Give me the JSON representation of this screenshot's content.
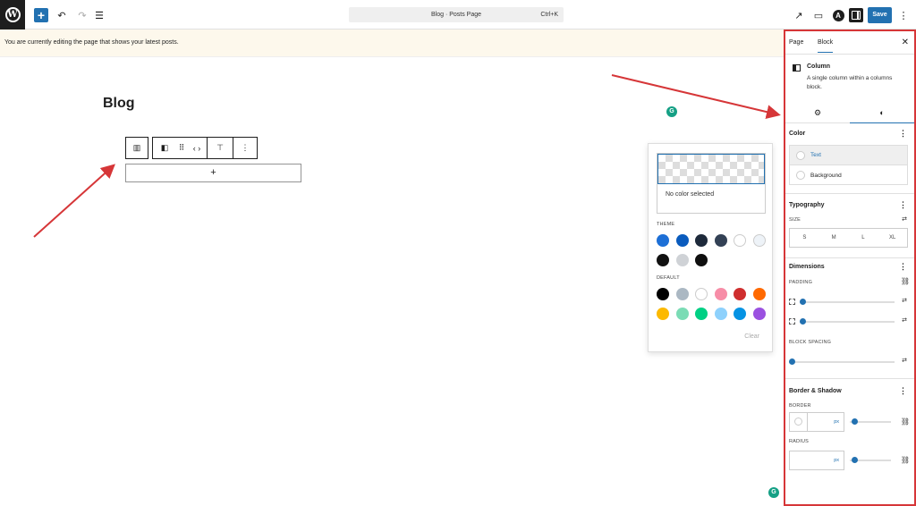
{
  "topbar": {
    "logo_letter": "W",
    "add_symbol": "+",
    "undo_icon": "↶",
    "redo_icon": "↷",
    "doc_overview_icon": "☰",
    "command": {
      "title": "Blog · Posts Page",
      "shortcut": "Ctrl+K"
    },
    "external_icon": "↗",
    "preview_icon": "▭",
    "astra_letter": "A",
    "save_label": "Save",
    "more_icon": "⋮"
  },
  "notice": {
    "text": "You are currently editing the page that shows your latest posts."
  },
  "canvas": {
    "page_title": "Blog",
    "block_toolbar": {
      "parent_icon": "▥",
      "column_icon": "◧",
      "drag_icon": "⠿",
      "move_icon": "‹ ›",
      "align_icon": "⊤",
      "options_icon": "⋮"
    },
    "add_block_symbol": "+",
    "grammarly_letter": "G"
  },
  "color_popover": {
    "no_color_label": "No color selected",
    "theme_label": "THEME",
    "theme_colors": [
      "#1d6fd6",
      "#0a5bbd",
      "#1e2a3b",
      "#334155",
      "#ffffff",
      "#eef3f8",
      "#111111",
      "#cfd2d6",
      "#0f0f0f"
    ],
    "default_label": "DEFAULT",
    "default_colors": [
      "#000000",
      "#abb8c3",
      "#ffffff",
      "#f78da7",
      "#cf2e2e",
      "#ff6900",
      "#fcb900",
      "#7bdcb5",
      "#00d084",
      "#8ed1fc",
      "#0693e3",
      "#9b51e0"
    ],
    "clear_label": "Clear"
  },
  "sidebar": {
    "tabs": [
      "Page",
      "Block"
    ],
    "close_icon": "✕",
    "block": {
      "name": "Column",
      "description": "A single column within a columns block."
    },
    "settings_icon": "⚙",
    "styles_icon": "◐",
    "color": {
      "title": "Color",
      "items": [
        "Text",
        "Background"
      ]
    },
    "typography": {
      "title": "Typography",
      "size_label": "SIZE",
      "sizes": [
        "S",
        "M",
        "L",
        "XL"
      ]
    },
    "dimensions": {
      "title": "Dimensions",
      "padding_label": "PADDING",
      "block_spacing_label": "BLOCK SPACING"
    },
    "border_shadow": {
      "title": "Border & Shadow",
      "border_label": "BORDER",
      "radius_label": "RADIUS",
      "unit": "px"
    },
    "more_icon": "⋮",
    "adjust_icon": "⇄",
    "link_icon": "⛓"
  },
  "colors": {
    "accent": "#2271b1",
    "annotation": "#d63638",
    "notice_bg": "#fdf8ec"
  }
}
